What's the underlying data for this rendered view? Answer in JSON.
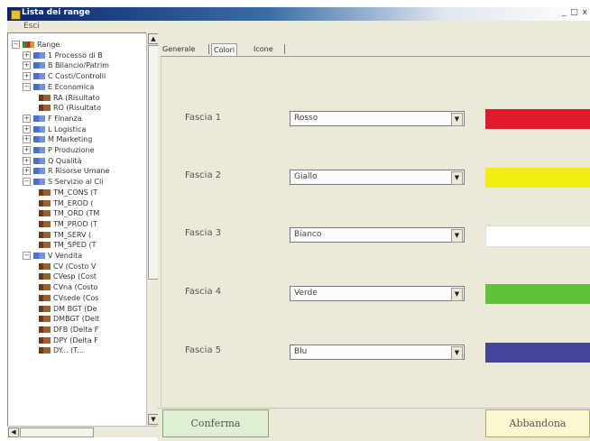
{
  "window": {
    "title": "Lista dei range",
    "controls": "_ □ x"
  },
  "menu": {
    "esci": "Esci"
  },
  "tree": {
    "items": [
      {
        "label": "Range",
        "level": 0,
        "expander": "−",
        "icon": "root"
      },
      {
        "label": "1 Processo di B",
        "level": 1,
        "expander": "+",
        "icon": "cat"
      },
      {
        "label": "B Bilancio/Patrim",
        "level": 1,
        "expander": "+",
        "icon": "cat"
      },
      {
        "label": "C Costi/Controlli",
        "level": 1,
        "expander": "+",
        "icon": "cat"
      },
      {
        "label": "E Economica",
        "level": 1,
        "expander": "−",
        "icon": "cat"
      },
      {
        "label": "RA (Risultato",
        "level": 2,
        "expander": "",
        "icon": "leaf"
      },
      {
        "label": "RO (Risultato",
        "level": 2,
        "expander": "",
        "icon": "leaf"
      },
      {
        "label": "F Finanza",
        "level": 1,
        "expander": "+",
        "icon": "cat"
      },
      {
        "label": "L Logistica",
        "level": 1,
        "expander": "+",
        "icon": "cat"
      },
      {
        "label": "M Marketing",
        "level": 1,
        "expander": "+",
        "icon": "cat"
      },
      {
        "label": "P Produzione",
        "level": 1,
        "expander": "+",
        "icon": "cat"
      },
      {
        "label": "Q Qualità",
        "level": 1,
        "expander": "+",
        "icon": "cat"
      },
      {
        "label": "R Risorse Umane",
        "level": 1,
        "expander": "+",
        "icon": "cat"
      },
      {
        "label": "S Servizio al Cli",
        "level": 1,
        "expander": "−",
        "icon": "cat"
      },
      {
        "label": "TM_CONS (T",
        "level": 2,
        "expander": "",
        "icon": "leaf"
      },
      {
        "label": "TM_EROD (",
        "level": 2,
        "expander": "",
        "icon": "leaf"
      },
      {
        "label": "TM_ORD (TM",
        "level": 2,
        "expander": "",
        "icon": "leaf"
      },
      {
        "label": "TM_PROD (T",
        "level": 2,
        "expander": "",
        "icon": "leaf"
      },
      {
        "label": "TM_SERV (",
        "level": 2,
        "expander": "",
        "icon": "leaf"
      },
      {
        "label": "TM_SPED (T",
        "level": 2,
        "expander": "",
        "icon": "leaf"
      },
      {
        "label": "V Vendita",
        "level": 1,
        "expander": "−",
        "icon": "cat"
      },
      {
        "label": "CV (Costo V",
        "level": 2,
        "expander": "",
        "icon": "leaf"
      },
      {
        "label": "CVesp (Cost",
        "level": 2,
        "expander": "",
        "icon": "leaf"
      },
      {
        "label": "CVna (Costo",
        "level": 2,
        "expander": "",
        "icon": "leaf"
      },
      {
        "label": "CVsede (Cos",
        "level": 2,
        "expander": "",
        "icon": "leaf"
      },
      {
        "label": "DM BGT (De",
        "level": 2,
        "expander": "",
        "icon": "leaf"
      },
      {
        "label": "DMBGT (Delt",
        "level": 2,
        "expander": "",
        "icon": "leaf"
      },
      {
        "label": "DFB (Delta F",
        "level": 2,
        "expander": "",
        "icon": "leaf"
      },
      {
        "label": "DPY (Delta F",
        "level": 2,
        "expander": "",
        "icon": "leaf"
      },
      {
        "label": "DY... (T...",
        "level": 2,
        "expander": "",
        "icon": "leaf"
      }
    ]
  },
  "tabs": [
    {
      "label": "Generale",
      "active": false
    },
    {
      "label": "Colori",
      "active": true
    },
    {
      "label": "Icone",
      "active": false
    }
  ],
  "bands": [
    {
      "label": "Fascia 1",
      "value": "Rosso",
      "color": "#e0192b"
    },
    {
      "label": "Fascia 2",
      "value": "Giallo",
      "color": "#f2ee10"
    },
    {
      "label": "Fascia 3",
      "value": "Bianco",
      "color": "#ffffff"
    },
    {
      "label": "Fascia 4",
      "value": "Verde",
      "color": "#5ec336"
    },
    {
      "label": "Fascia 5",
      "value": "Blu",
      "color": "#44449a"
    }
  ],
  "buttons": {
    "confirm": "Conferma",
    "cancel": "Abbandona"
  }
}
